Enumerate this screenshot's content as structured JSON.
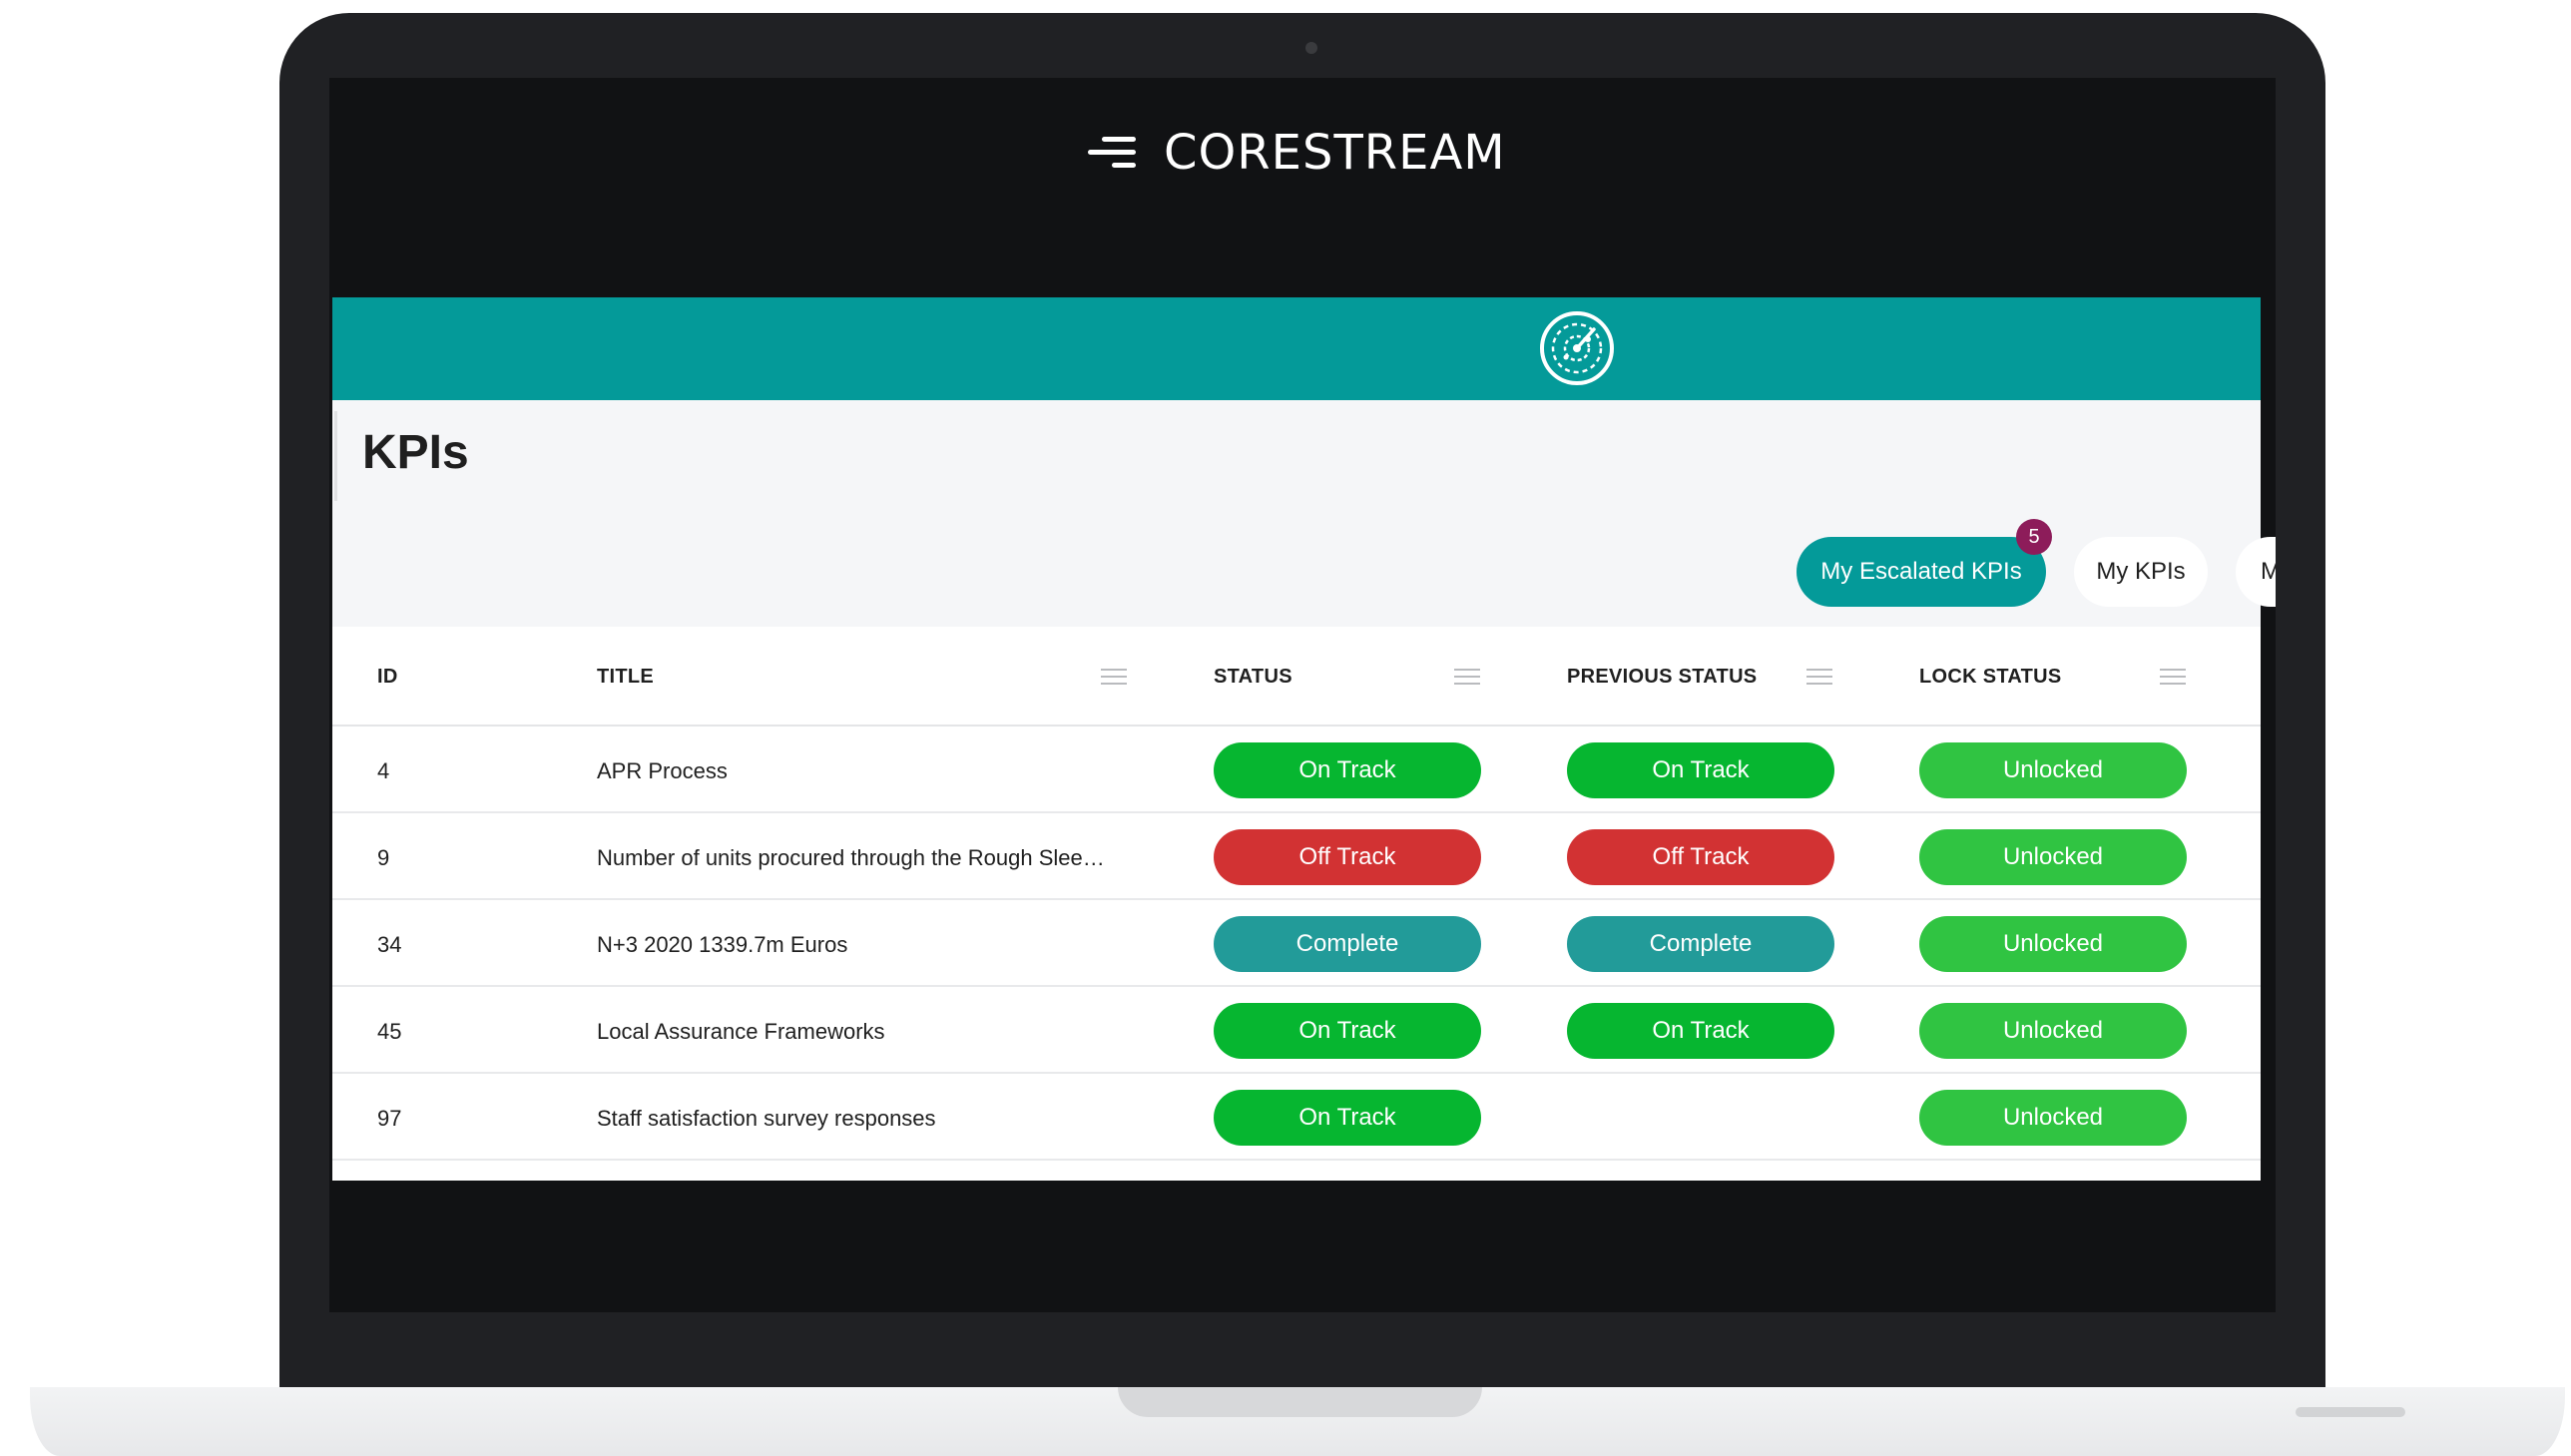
{
  "brand": {
    "name": "CORESTREAM"
  },
  "page": {
    "title": "KPIs"
  },
  "tabs": [
    {
      "label": "My Escalated KPIs",
      "badge": "5",
      "active": true
    },
    {
      "label": "My KPIs",
      "active": false
    },
    {
      "label": "My Archived KPIs",
      "active": false
    }
  ],
  "table": {
    "columns": [
      "ID",
      "TITLE",
      "STATUS",
      "PREVIOUS STATUS",
      "LOCK STATUS"
    ],
    "rows": [
      {
        "id": "4",
        "title": "APR Process",
        "status": "On Track",
        "previous_status": "On Track",
        "lock_status": "Unlocked"
      },
      {
        "id": "9",
        "title": "Number of units procured through the Rough Slee…",
        "status": "Off Track",
        "previous_status": "Off Track",
        "lock_status": "Unlocked"
      },
      {
        "id": "34",
        "title": "N+3 2020 1339.7m Euros",
        "status": "Complete",
        "previous_status": "Complete",
        "lock_status": "Unlocked"
      },
      {
        "id": "45",
        "title": "Local Assurance Frameworks",
        "status": "On Track",
        "previous_status": "On Track",
        "lock_status": "Unlocked"
      },
      {
        "id": "97",
        "title": "Staff satisfaction survey responses",
        "status": "On Track",
        "previous_status": "",
        "lock_status": "Unlocked"
      }
    ]
  },
  "colors": {
    "accent": "#049a99",
    "on_track": "#06b630",
    "off_track": "#d23233",
    "complete": "#229b99",
    "unlocked": "#30c442",
    "badge": "#8d1c5a"
  },
  "icons": {
    "header": "radar-icon",
    "column_menu": "column-menu-icon",
    "brand": "corestream-logo-mark-icon"
  }
}
